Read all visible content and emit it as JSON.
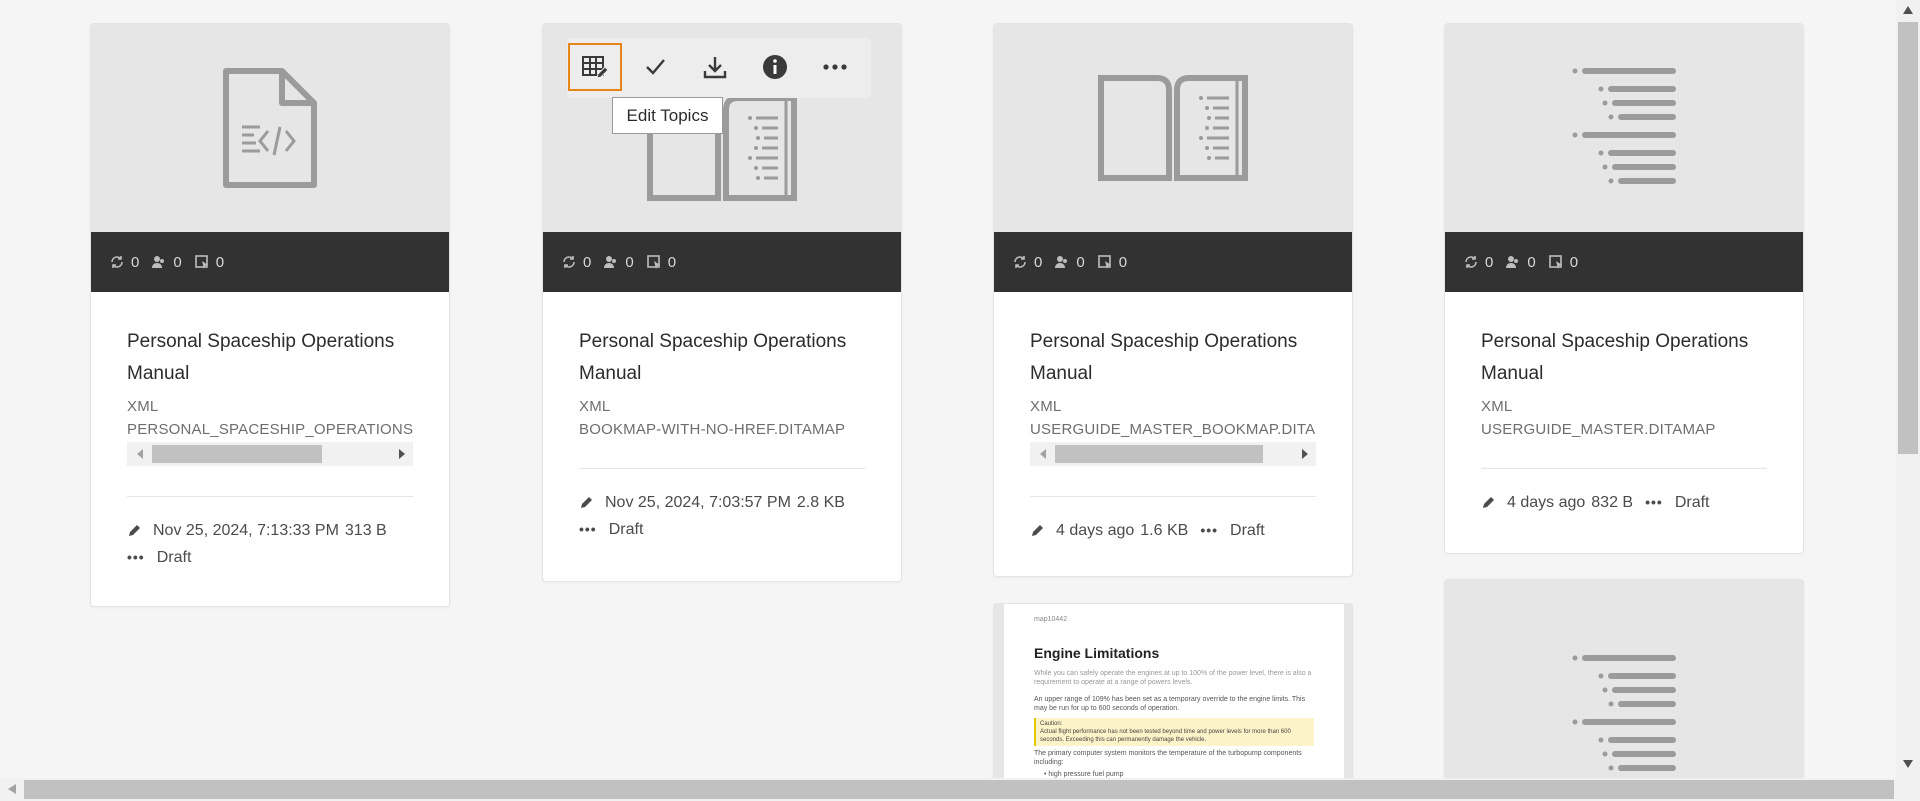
{
  "toolbar": {
    "edit_topics_tooltip": "Edit Topics",
    "buttons": [
      "edit-topics-icon",
      "check-icon",
      "download-icon",
      "info-icon",
      "more-icon"
    ]
  },
  "cards": [
    {
      "stats": {
        "a": "0",
        "b": "0",
        "c": "0"
      },
      "title": "Personal Spaceship Operations Manual",
      "type": "XML",
      "file": "PERSONAL_SPACESHIP_OPERATIONS_",
      "date": "Nov 25, 2024, 7:13:33 PM",
      "size": "313 B",
      "status": "Draft"
    },
    {
      "stats": {
        "a": "0",
        "b": "0",
        "c": "0"
      },
      "title": "Personal Spaceship Operations Manual",
      "type": "XML",
      "file": "BOOKMAP-WITH-NO-HREF.DITAMAP",
      "date": "Nov 25, 2024, 7:03:57 PM",
      "size": "2.8 KB",
      "status": "Draft"
    },
    {
      "stats": {
        "a": "0",
        "b": "0",
        "c": "0"
      },
      "title": "Personal Spaceship Operations Manual",
      "type": "XML",
      "file": "USERGUIDE_MASTER_BOOKMAP.DITA",
      "date": "4 days ago",
      "size": "1.6 KB",
      "status": "Draft"
    },
    {
      "stats": {
        "a": "0",
        "b": "0",
        "c": "0"
      },
      "title": "Personal Spaceship Operations Manual",
      "type": "XML",
      "file": "USERGUIDE_MASTER.DITAMAP",
      "date": "4 days ago",
      "size": "832 B",
      "status": "Draft"
    }
  ],
  "preview": {
    "id": "map10442",
    "heading": "Engine Limitations",
    "p1": "While you can safely operate the engines at up to 100% of the power level, there is also a requirement to operate at a range of powers levels.",
    "p2": "An upper range of 109% has been set as a temporary override to the engine limits. This may be run for up to 600 seconds of operation.",
    "caution_title": "Caution:",
    "caution_text": "Actual flight performance has not been tested beyond time and power levels for more than 600 seconds. Exceeding this can permanently damage the vehicle.",
    "p3": "The primary computer system monitors the temperature of the turbopump components including:",
    "bullet": "high pressure fuel pump"
  }
}
